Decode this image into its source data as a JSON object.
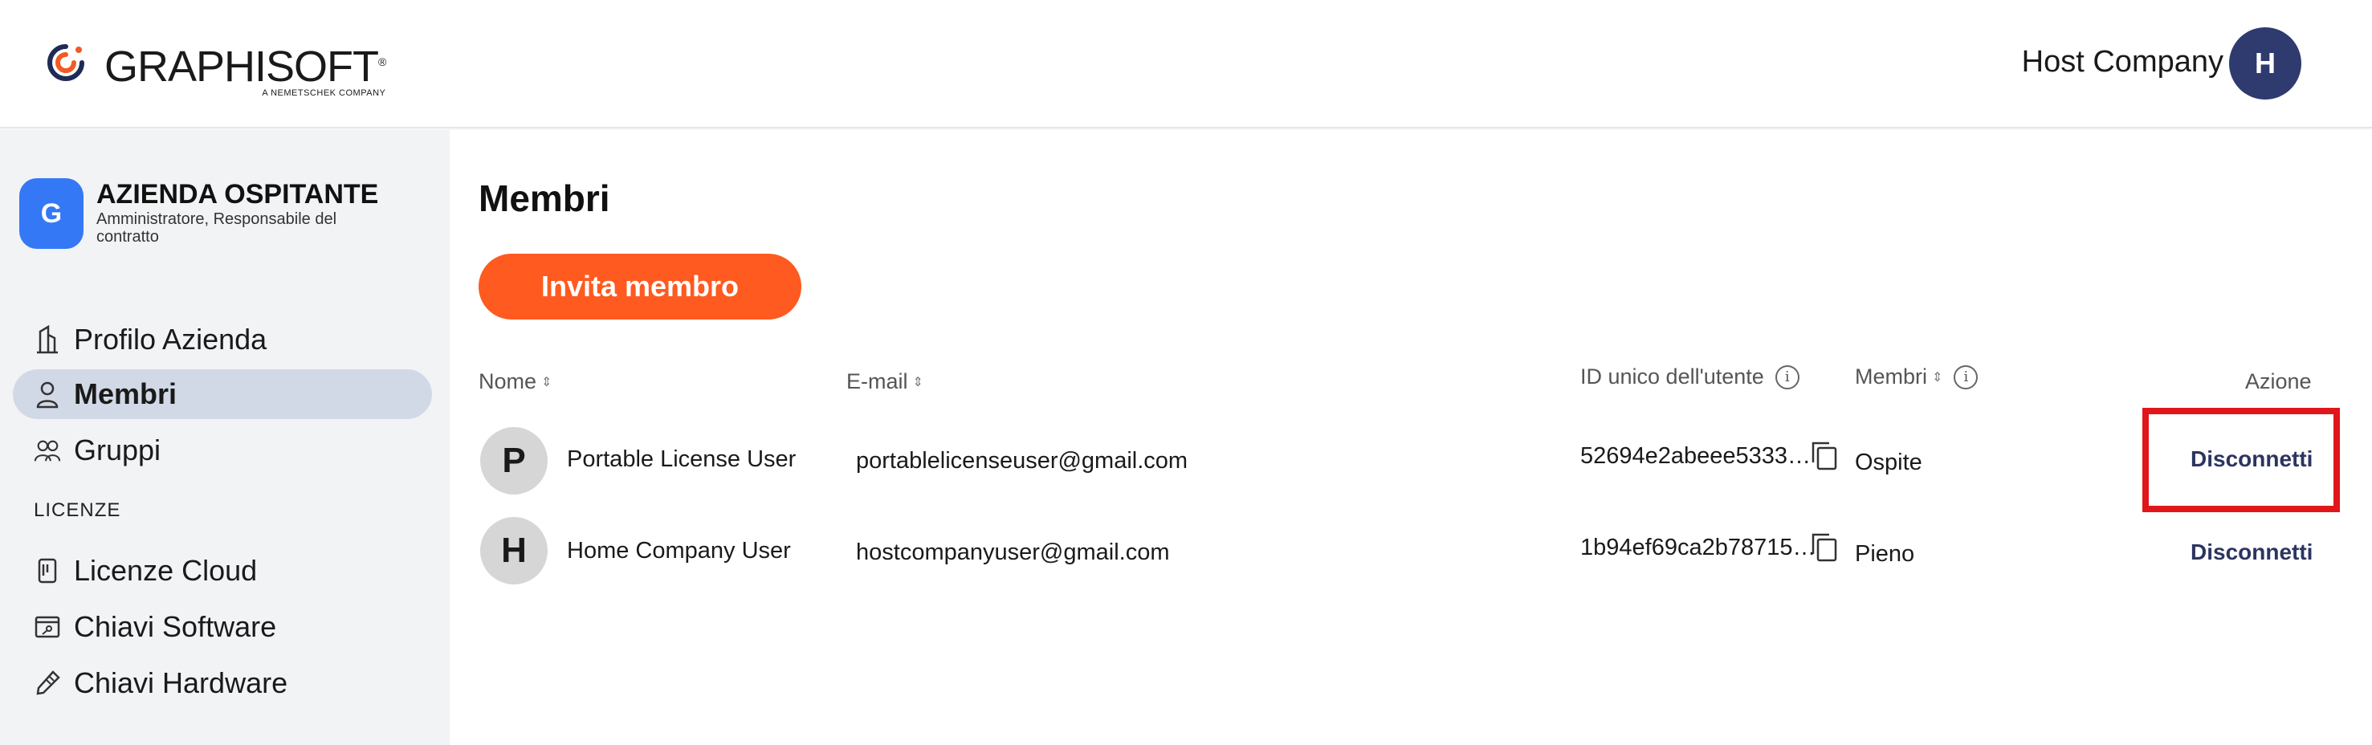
{
  "header": {
    "logo_word": "GRAPHISOFT",
    "logo_sub": "A NEMETSCHEK COMPANY",
    "account_name": "Host Company",
    "account_initial": "H"
  },
  "sidebar": {
    "org": {
      "initial": "G",
      "name": "AZIENDA OSPITANTE",
      "role": "Amministratore, Responsabile del contratto"
    },
    "items": [
      {
        "label": "Profilo Azienda",
        "icon": "building-icon"
      },
      {
        "label": "Membri",
        "icon": "person-icon",
        "active": true
      },
      {
        "label": "Gruppi",
        "icon": "group-icon"
      }
    ],
    "section_title": "LICENZE",
    "license_items": [
      {
        "label": "Licenze Cloud",
        "icon": "cloud-license-icon"
      },
      {
        "label": "Chiavi Software",
        "icon": "software-key-icon"
      },
      {
        "label": "Chiavi Hardware",
        "icon": "hardware-key-icon"
      }
    ]
  },
  "main": {
    "title": "Membri",
    "invite_label": "Invita membro",
    "columns": {
      "name": "Nome",
      "email": "E-mail",
      "user_id": "ID unico dell'utente",
      "members": "Membri",
      "action": "Azione"
    },
    "rows": [
      {
        "initial": "P",
        "name": "Portable License User",
        "email": "portablelicenseuser@gmail.com",
        "user_id": "52694e2abeee5333…",
        "membership": "Ospite",
        "action": "Disconnetti"
      },
      {
        "initial": "H",
        "name": "Home Company User",
        "email": "hostcompanyuser@gmail.com",
        "user_id": "1b94ef69ca2b78715…",
        "membership": "Pieno",
        "action": "Disconnetti"
      }
    ]
  },
  "colors": {
    "accent_orange": "#ff5a1f",
    "org_blue": "#3578f6",
    "account_navy": "#2f3a6e",
    "highlight_red": "#e0161b"
  }
}
